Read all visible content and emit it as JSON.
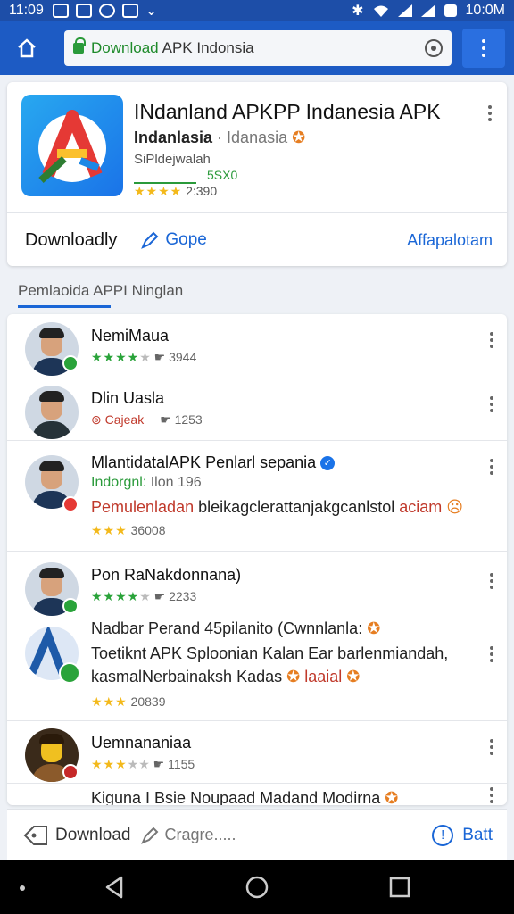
{
  "status_bar": {
    "time": "11:09",
    "right_time": "10:0M"
  },
  "browser": {
    "url_highlight": "Download",
    "url_rest": "APK Indonsia"
  },
  "app": {
    "title": "INdanland APKPP Indanesia APK",
    "subtitle_bold": "Indanlasia",
    "subtitle_rest": "· Idanasia",
    "developer": "SiPldejwalah",
    "size": "5SX0",
    "stars": "★★★★",
    "rating_count": "2:390",
    "action_download": "Downloadly",
    "action_gope": "Gope",
    "action_right": "Affapalotam"
  },
  "section": {
    "title": "Pemlaoida APPI Ninglan"
  },
  "list": [
    {
      "name": "NemiMaua",
      "stars": "★★★★",
      "stars_off": "★",
      "count": "3944"
    },
    {
      "name": "Dlin Uasla",
      "category": "Cajeak",
      "count": "1253"
    },
    {
      "name": "MlantidatalAPK Penlarl sepania",
      "line2_green": "Indorgnl:",
      "line2_grey": "Ilon 196",
      "line3_cat": "Pemulenladan",
      "line3_rest": "bleikagclerattanjakgcanlstol",
      "line3_tail": "aciam",
      "stars": "★★★",
      "count": "36008"
    },
    {
      "name": "Pon RaNakdonnana)",
      "stars": "★★★★",
      "stars_off": "★",
      "count": "2233"
    },
    {
      "line1": "Nadbar Perand 45pilanito (Cwnnlanla:",
      "line2": "Toetiknt APK Sploonian Kalan Ear barlenmiandah,",
      "line3_rest": "kasmalNerbainaksh Kadas",
      "line3_cat": "laaial",
      "stars": "★★★",
      "count": "20839"
    },
    {
      "name": "Uemnananiaa",
      "stars": "★★★",
      "stars_off": "★★",
      "count": "1155"
    },
    {
      "line1": "Kiguna I Bsie Noupaad Madand Modirna"
    }
  ],
  "bottom_bar": {
    "download": "Download",
    "create": "Cragre.....",
    "right": "Batt"
  },
  "colors": {
    "status_bar": "#1d4ea8",
    "browser_bar": "#1d5bc4",
    "accent": "#1a66d6",
    "green": "#2a9a3a",
    "star": "#f3b91b"
  }
}
